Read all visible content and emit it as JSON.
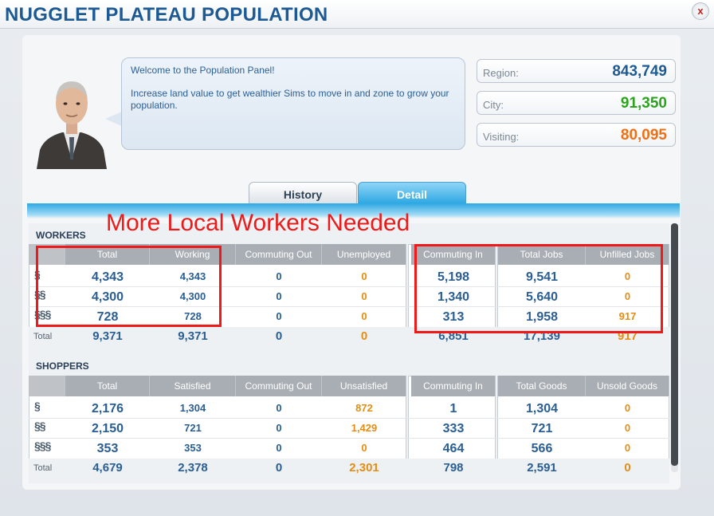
{
  "window": {
    "title": "NUGGLET PLATEAU POPULATION",
    "close_label": "x"
  },
  "welcome": {
    "line1": "Welcome to the Population Panel!",
    "line2": "Increase land value to get wealthier Sims to move in and zone to grow your population."
  },
  "stats": {
    "region_label": "Region:",
    "region_value": "843,749",
    "city_label": "City:",
    "city_value": "91,350",
    "visiting_label": "Visiting:",
    "visiting_value": "80,095"
  },
  "colors": {
    "region": "#1d5a93",
    "city": "#2ca31c",
    "visiting": "#ef6f14",
    "annotation": "#ee1a1a",
    "value_blue": "#2a5e93",
    "value_orange": "#e38d12"
  },
  "tabs": {
    "history": "History",
    "detail": "Detail"
  },
  "annotation": {
    "text": "More Local Workers Needed"
  },
  "wealth_icons": [
    "§",
    "§§",
    "§§§"
  ],
  "total_label": "Total",
  "workers": {
    "title": "WORKERS",
    "headers": [
      "Total",
      "Working",
      "Commuting Out",
      "Unemployed",
      "Commuting In",
      "Total Jobs",
      "Unfilled Jobs"
    ],
    "rows": [
      [
        "4,343",
        "4,343",
        "0",
        "0",
        "5,198",
        "9,541",
        "0"
      ],
      [
        "4,300",
        "4,300",
        "0",
        "0",
        "1,340",
        "5,640",
        "0"
      ],
      [
        "728",
        "728",
        "0",
        "0",
        "313",
        "1,958",
        "917"
      ]
    ],
    "totals": [
      "9,371",
      "9,371",
      "0",
      "0",
      "6,851",
      "17,139",
      "917"
    ]
  },
  "shoppers": {
    "title": "SHOPPERS",
    "headers": [
      "Total",
      "Satisfied",
      "Commuting Out",
      "Unsatisfied",
      "Commuting In",
      "Total Goods",
      "Unsold Goods"
    ],
    "rows": [
      [
        "2,176",
        "1,304",
        "0",
        "872",
        "1",
        "1,304",
        "0"
      ],
      [
        "2,150",
        "721",
        "0",
        "1,429",
        "333",
        "721",
        "0"
      ],
      [
        "353",
        "353",
        "0",
        "0",
        "464",
        "566",
        "0"
      ]
    ],
    "totals": [
      "4,679",
      "2,378",
      "0",
      "2,301",
      "798",
      "2,591",
      "0"
    ]
  }
}
